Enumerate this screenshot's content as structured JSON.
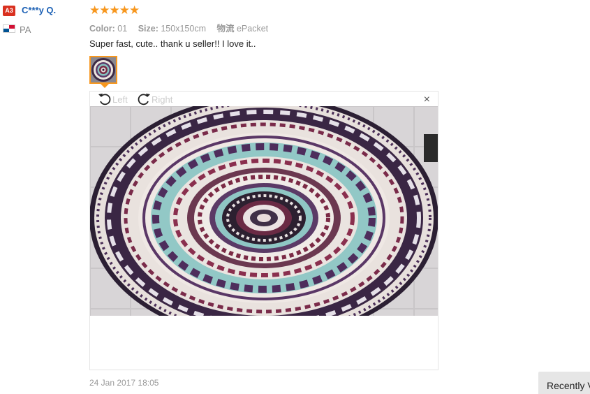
{
  "reviewer": {
    "level_badge": "A3",
    "name": "C***y Q.",
    "country_code": "PA",
    "flag": "panama-flag-icon"
  },
  "rating": {
    "stars": 5,
    "max": 5,
    "display": "★★★★★",
    "color": "#f7971e"
  },
  "order_info": {
    "color_label": "Color:",
    "color_value": "01",
    "size_label": "Size:",
    "size_value": "150x150cm",
    "shipping_label": "物流",
    "shipping_value": "ePacket"
  },
  "review_text": "Super fast, cute.. thank u seller!! I love it..",
  "image_viewer": {
    "rotate_left_label": "Left",
    "rotate_right_label": "Right",
    "close_label": "×",
    "image_description": "round mandala tapestry photo"
  },
  "date": "24 Jan 2017 18:05",
  "recently_viewed_label": "Recently Viewed",
  "colors": {
    "badge": "#d9301f",
    "name": "#1a5fb4",
    "accent": "#f7971e"
  }
}
